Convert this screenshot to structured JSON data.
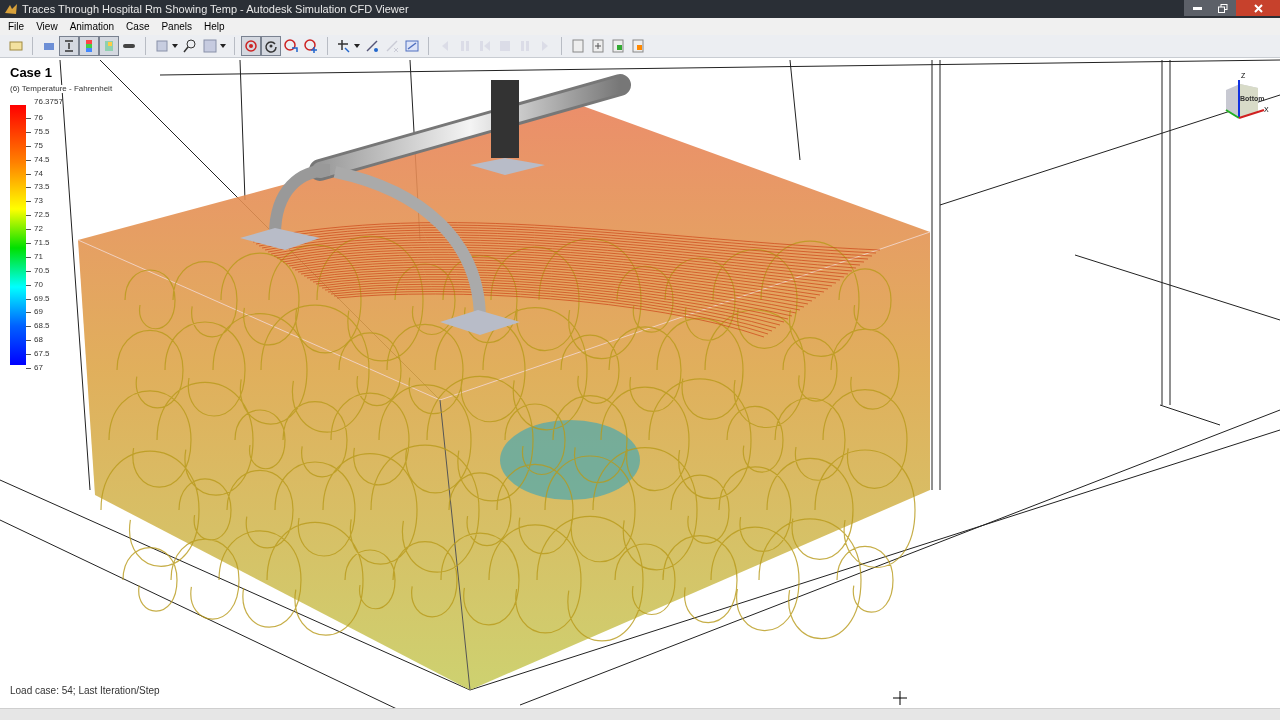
{
  "window": {
    "title": "Traces Through Hospital Rm Showing Temp - Autodesk Simulation CFD Viewer"
  },
  "menu": [
    "File",
    "View",
    "Animation",
    "Case",
    "Panels",
    "Help"
  ],
  "toolbar": [
    {
      "pressed": false,
      "disabled": false,
      "dropdown": false
    },
    {
      "pressed": false,
      "disabled": false,
      "dropdown": false
    },
    {
      "pressed": true,
      "disabled": false,
      "dropdown": false
    },
    {
      "pressed": true,
      "disabled": false,
      "dropdown": false
    },
    {
      "pressed": true,
      "disabled": false,
      "dropdown": false
    },
    {
      "pressed": false,
      "disabled": false,
      "dropdown": false
    },
    {
      "pressed": false,
      "disabled": false,
      "dropdown": true
    },
    {
      "pressed": false,
      "disabled": false,
      "dropdown": false
    },
    {
      "pressed": false,
      "disabled": false,
      "dropdown": true
    },
    {
      "pressed": true,
      "disabled": false,
      "dropdown": false
    },
    {
      "pressed": true,
      "disabled": false,
      "dropdown": false
    },
    {
      "pressed": false,
      "disabled": false,
      "dropdown": false
    },
    {
      "pressed": false,
      "disabled": false,
      "dropdown": false
    },
    {
      "pressed": false,
      "disabled": false,
      "dropdown": true
    },
    {
      "pressed": false,
      "disabled": false,
      "dropdown": false
    },
    {
      "pressed": false,
      "disabled": true,
      "dropdown": false
    },
    {
      "pressed": false,
      "disabled": false,
      "dropdown": false
    },
    {
      "pressed": false,
      "disabled": true,
      "dropdown": false
    },
    {
      "pressed": false,
      "disabled": true,
      "dropdown": false
    },
    {
      "pressed": false,
      "disabled": true,
      "dropdown": false
    },
    {
      "pressed": false,
      "disabled": true,
      "dropdown": false
    },
    {
      "pressed": false,
      "disabled": true,
      "dropdown": false
    },
    {
      "pressed": false,
      "disabled": true,
      "dropdown": false
    },
    {
      "pressed": false,
      "disabled": false,
      "dropdown": false
    },
    {
      "pressed": false,
      "disabled": false,
      "dropdown": false
    },
    {
      "pressed": false,
      "disabled": false,
      "dropdown": false
    },
    {
      "pressed": false,
      "disabled": false,
      "dropdown": false
    }
  ],
  "case_label": "Case 1",
  "legend": {
    "title": "(6) Temperature - Fahrenheit",
    "max": "76.3757",
    "ticks": [
      "76",
      "75.5",
      "75",
      "74.5",
      "74",
      "73.5",
      "73",
      "72.5",
      "72",
      "71.5",
      "71",
      "70.5",
      "70",
      "69.5",
      "69",
      "68.5",
      "68",
      "67.5",
      "67"
    ]
  },
  "view_cube": {
    "face": "Bottom",
    "axes": [
      "Z",
      "X"
    ]
  },
  "status": "Load case: 54; Last Iteration/Step"
}
